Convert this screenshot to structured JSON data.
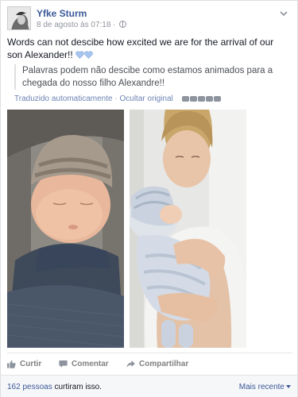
{
  "post": {
    "author": "Yfke Sturm",
    "timestamp": "8 de agosto às 07:18 ·",
    "text": "Words can not descibe how excited we are for the arrival of our son Alexander!!",
    "translation": "Palavras podem não descibe como estamos animados para a chegada do nosso filho Alexandre!!",
    "auto_translated": "Traduzido automaticamente",
    "separator": "·",
    "hide_original": "Ocultar original",
    "icons": {
      "avatar": "profile-photo",
      "privacy": "globe-icon",
      "menu": "chevron-down-icon",
      "emoji": "blue-heart-icon",
      "like": "thumbs-up-icon",
      "comment": "speech-bubble-icon",
      "share": "share-arrow-icon"
    }
  },
  "actions": {
    "like": "Curtir",
    "comment": "Comentar",
    "share": "Compartilhar"
  },
  "footer": {
    "likes_count": "162 pessoas",
    "likes_suffix": "curtiram isso.",
    "sort": "Mais recente"
  },
  "colors": {
    "link": "#3b5998",
    "muted": "#90949c",
    "text": "#141823"
  }
}
